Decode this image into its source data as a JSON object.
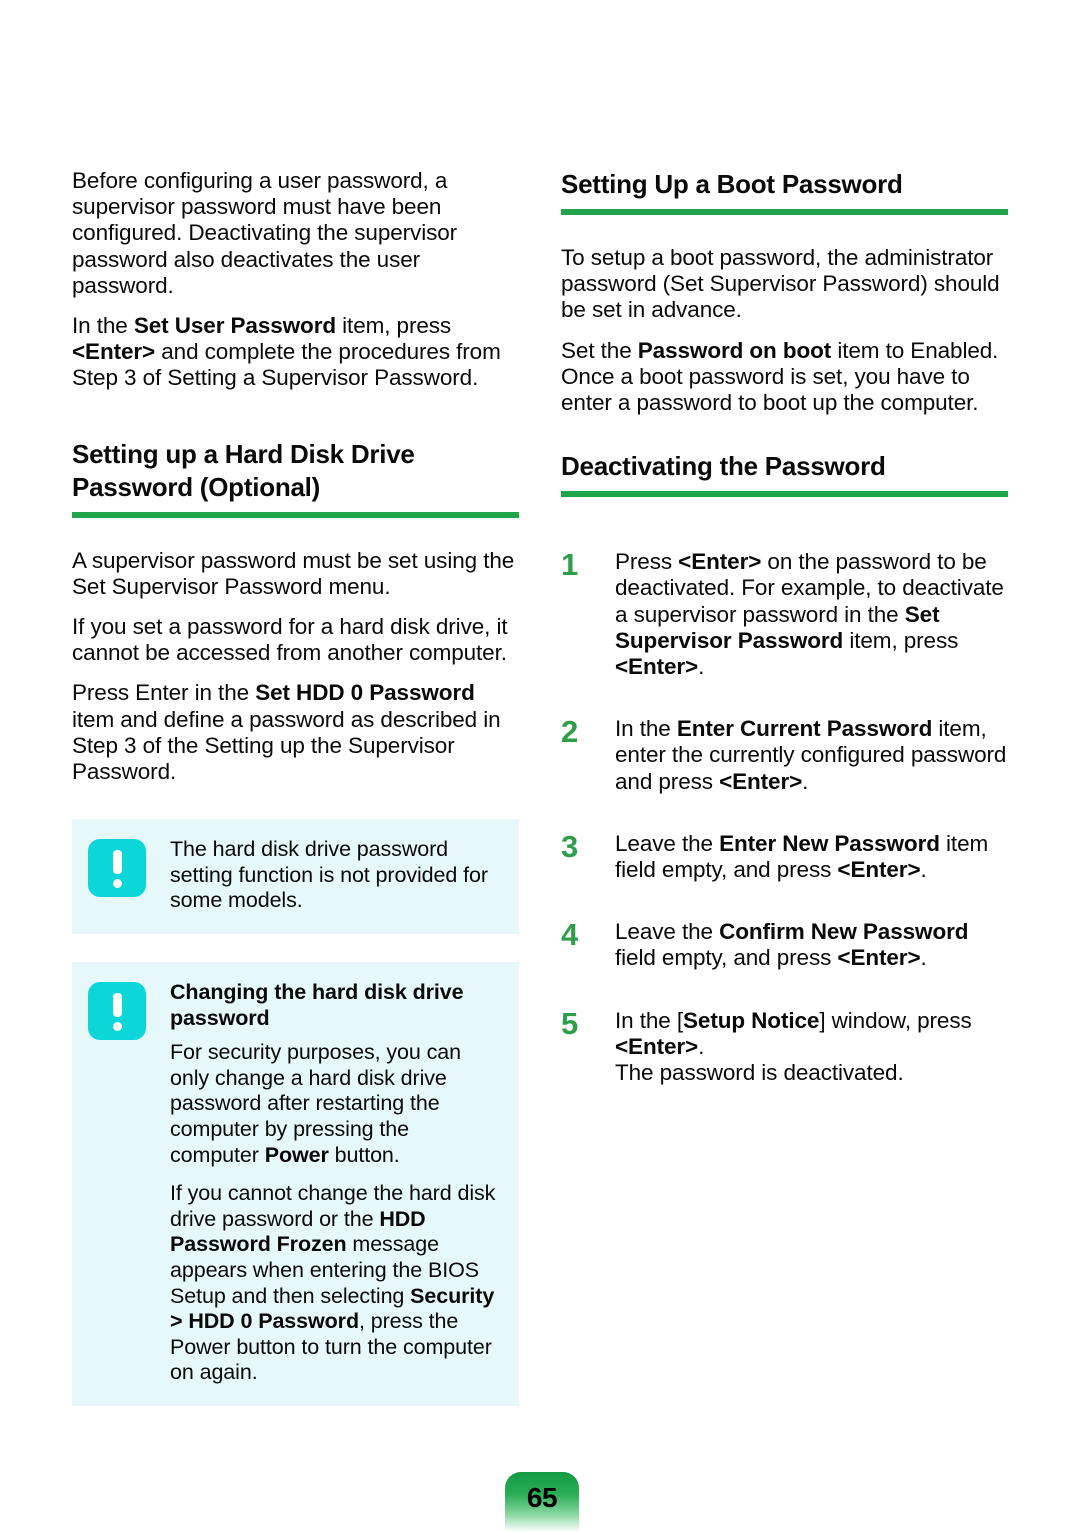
{
  "page": {
    "number": "65",
    "accent_green": "#22a44a",
    "step_number_green": "#2e9e4a",
    "note_box_bg": "#e6f8fa",
    "note_icon_color": "#0dd6d8"
  },
  "left_column": {
    "intro_paragraphs": [
      {
        "segments": [
          {
            "text": "Before configuring a user password, a supervisor password must have been configured. Deactivating the supervisor password also deactivates the user password.",
            "bold": false
          }
        ]
      },
      {
        "segments": [
          {
            "text": "In the ",
            "bold": false
          },
          {
            "text": "Set User Password",
            "bold": true
          },
          {
            "text": " item, press ",
            "bold": false
          },
          {
            "text": "<Enter>",
            "bold": true
          },
          {
            "text": " and complete the procedures from Step 3 of Setting a Supervisor Password.",
            "bold": false
          }
        ]
      }
    ],
    "heading": {
      "line1": "Setting up a Hard Disk Drive",
      "line2": "Password (Optional)"
    },
    "paragraphs": [
      {
        "segments": [
          {
            "text": "A supervisor password must be set using the Set Supervisor Password menu.",
            "bold": false
          }
        ]
      },
      {
        "segments": [
          {
            "text": "If you set a password for a hard disk drive, it cannot be accessed from another computer.",
            "bold": false
          }
        ]
      },
      {
        "segments": [
          {
            "text": "Press Enter in the ",
            "bold": false
          },
          {
            "text": "Set HDD 0 Password",
            "bold": true
          },
          {
            "text": " item and define a password as described in Step 3 of the Setting up the Supervisor Password.",
            "bold": false
          }
        ]
      }
    ],
    "note_box_1": {
      "icon": "exclamation-icon",
      "title": null,
      "paragraphs": [
        {
          "segments": [
            {
              "text": "The hard disk drive password setting function is not provided for some models.",
              "bold": false
            }
          ]
        }
      ]
    },
    "note_box_2": {
      "icon": "exclamation-icon",
      "title": "Changing the hard disk drive password",
      "paragraphs": [
        {
          "segments": [
            {
              "text": "For security purposes, you can only change a hard disk drive password after restarting the computer by pressing the computer ",
              "bold": false
            },
            {
              "text": "Power",
              "bold": true
            },
            {
              "text": " button.",
              "bold": false
            }
          ]
        },
        {
          "segments": [
            {
              "text": "If you cannot change the hard disk drive password or the ",
              "bold": false
            },
            {
              "text": "HDD Password Frozen",
              "bold": true
            },
            {
              "text": " message appears when entering the BIOS Setup and then selecting ",
              "bold": false
            },
            {
              "text": "Security > HDD 0 Password",
              "bold": true
            },
            {
              "text": ", press the Power button to turn the computer on again.",
              "bold": false
            }
          ]
        }
      ]
    }
  },
  "right_column": {
    "heading_1": "Setting Up a Boot Password",
    "paragraphs_1": [
      {
        "segments": [
          {
            "text": "To setup a boot password, the administrator password (Set Supervisor Password) should be set in advance.",
            "bold": false
          }
        ]
      },
      {
        "segments": [
          {
            "text": "Set the ",
            "bold": false
          },
          {
            "text": "Password on boot",
            "bold": true
          },
          {
            "text": " item to Enabled. Once a boot password is set, you have to enter a password to boot up the computer.",
            "bold": false
          }
        ]
      }
    ],
    "heading_2": "Deactivating the Password",
    "steps": [
      {
        "number": "1",
        "segments": [
          {
            "text": "Press ",
            "bold": false
          },
          {
            "text": "<Enter>",
            "bold": true
          },
          {
            "text": " on the password to be deactivated. For example, to deactivate a supervisor password in the ",
            "bold": false
          },
          {
            "text": "Set Supervisor Password",
            "bold": true
          },
          {
            "text": " item, press ",
            "bold": false
          },
          {
            "text": "<Enter>",
            "bold": true
          },
          {
            "text": ".",
            "bold": false
          }
        ]
      },
      {
        "number": "2",
        "segments": [
          {
            "text": "In the ",
            "bold": false
          },
          {
            "text": "Enter Current Password",
            "bold": true
          },
          {
            "text": " item, enter the currently configured password and press ",
            "bold": false
          },
          {
            "text": "<Enter>",
            "bold": true
          },
          {
            "text": ".",
            "bold": false
          }
        ]
      },
      {
        "number": "3",
        "segments": [
          {
            "text": "Leave the ",
            "bold": false
          },
          {
            "text": "Enter New Password",
            "bold": true
          },
          {
            "text": " item field empty, and press ",
            "bold": false
          },
          {
            "text": "<Enter>",
            "bold": true
          },
          {
            "text": ".",
            "bold": false
          }
        ]
      },
      {
        "number": "4",
        "segments": [
          {
            "text": "Leave the ",
            "bold": false
          },
          {
            "text": "Confirm New Password",
            "bold": true
          },
          {
            "text": " field empty, and press ",
            "bold": false
          },
          {
            "text": "<Enter>",
            "bold": true
          },
          {
            "text": ".",
            "bold": false
          }
        ]
      },
      {
        "number": "5",
        "segments": [
          {
            "text": "In the [",
            "bold": false
          },
          {
            "text": "Setup Notice",
            "bold": true
          },
          {
            "text": "] window, press ",
            "bold": false
          },
          {
            "text": "<Enter>",
            "bold": true
          },
          {
            "text": ".\nThe password is deactivated.",
            "bold": false
          }
        ]
      }
    ]
  }
}
